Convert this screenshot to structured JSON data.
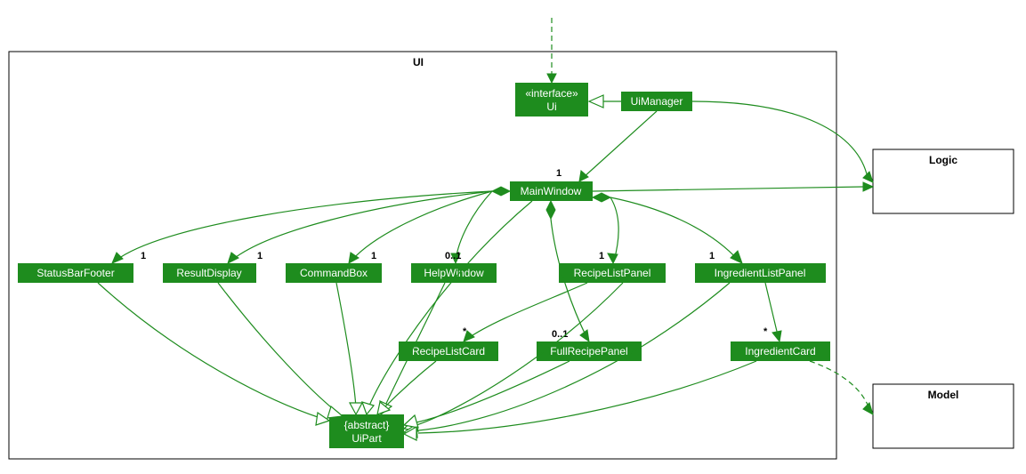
{
  "diagram": {
    "packages": {
      "ui": "UI",
      "logic": "Logic",
      "model": "Model"
    },
    "classes": {
      "uiInterface": {
        "stereotype": "«interface»",
        "name": "Ui"
      },
      "uiManager": {
        "name": "UiManager"
      },
      "mainWindow": {
        "name": "MainWindow"
      },
      "statusBarFooter": {
        "name": "StatusBarFooter"
      },
      "resultDisplay": {
        "name": "ResultDisplay"
      },
      "commandBox": {
        "name": "CommandBox"
      },
      "helpWindow": {
        "name": "HelpWindow"
      },
      "recipeListPanel": {
        "name": "RecipeListPanel"
      },
      "ingredientListPanel": {
        "name": "IngredientListPanel"
      },
      "recipeListCard": {
        "name": "RecipeListCard"
      },
      "fullRecipePanel": {
        "name": "FullRecipePanel"
      },
      "ingredientCard": {
        "name": "IngredientCard"
      },
      "uiPart": {
        "stereotype": "{abstract}",
        "name": "UiPart"
      }
    },
    "multiplicities": {
      "mainWindow": "1",
      "statusBarFooter": "1",
      "resultDisplay": "1",
      "commandBox": "1",
      "helpWindow": "0..1",
      "recipeListPanel": "1",
      "ingredientListPanel": "1",
      "recipeListCard": "*",
      "fullRecipePanel": "0..1",
      "ingredientCard": "*"
    }
  }
}
